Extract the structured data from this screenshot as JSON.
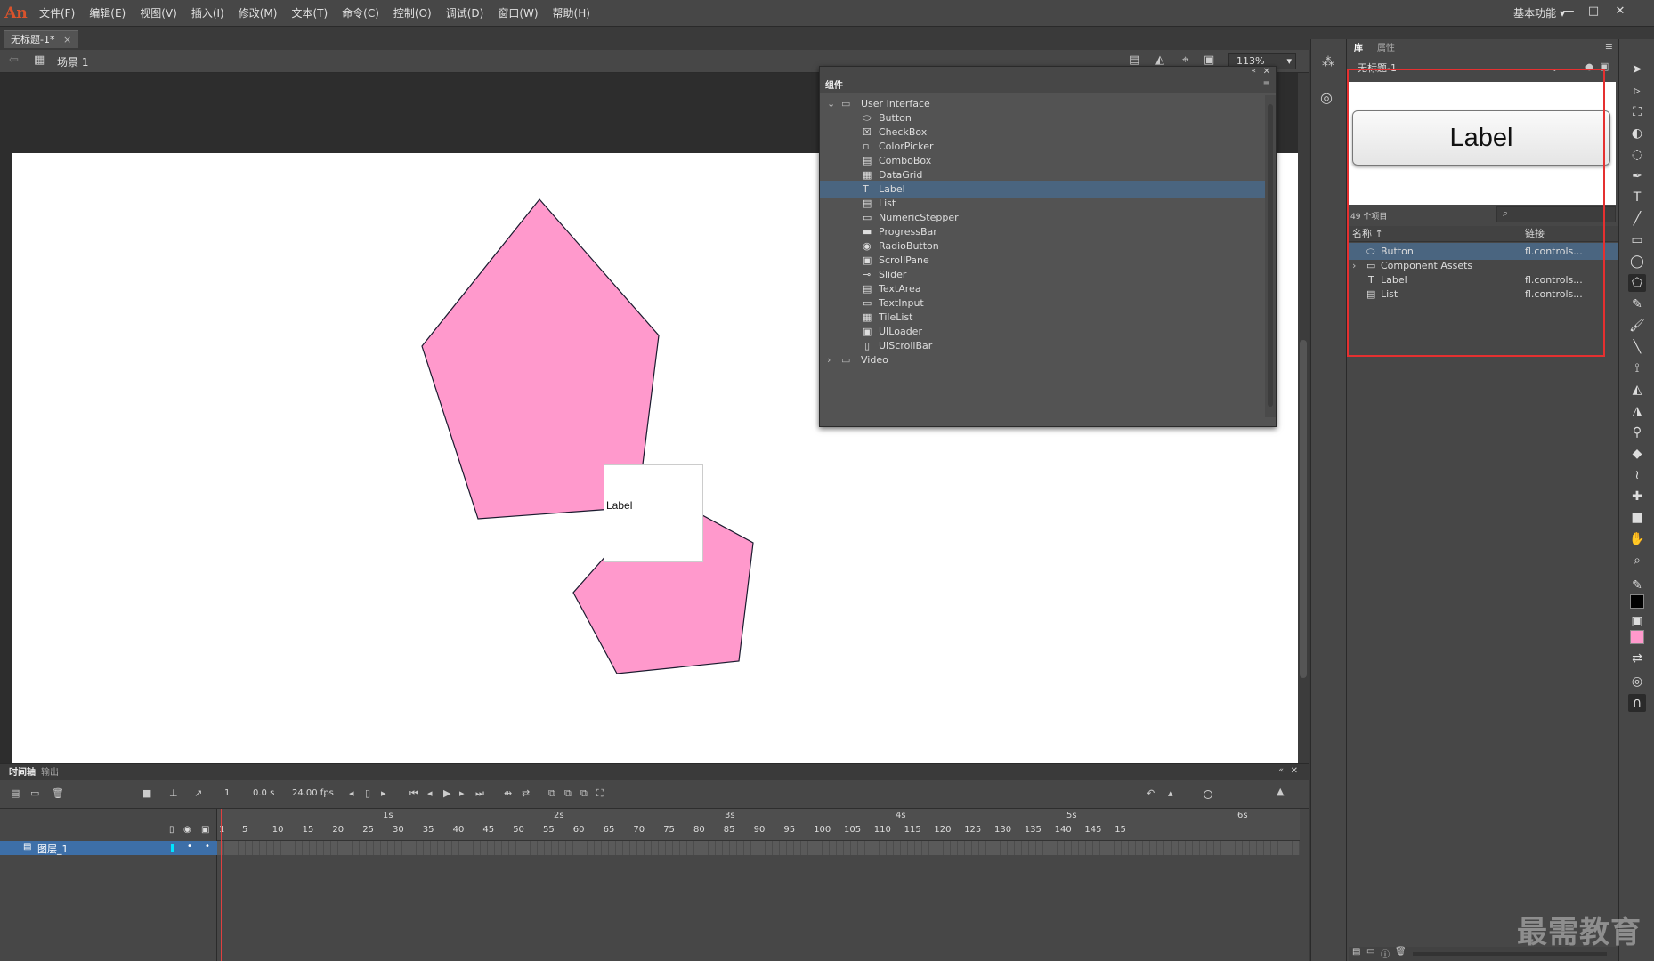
{
  "app": {
    "logo": "An"
  },
  "menu": [
    "文件(F)",
    "编辑(E)",
    "视图(V)",
    "插入(I)",
    "修改(M)",
    "文本(T)",
    "命令(C)",
    "控制(O)",
    "调试(D)",
    "窗口(W)",
    "帮助(H)"
  ],
  "workspace": "基本功能",
  "document": {
    "tab_title": "无标题-1*",
    "scene": "场景 1",
    "zoom": "113%"
  },
  "components_panel": {
    "tab": "组件",
    "folders": [
      {
        "name": "User Interface",
        "expanded": true,
        "items": [
          "Button",
          "CheckBox",
          "ColorPicker",
          "ComboBox",
          "DataGrid",
          "Label",
          "List",
          "NumericStepper",
          "ProgressBar",
          "RadioButton",
          "ScrollPane",
          "Slider",
          "TextArea",
          "TextInput",
          "TileList",
          "UILoader",
          "UIScrollBar"
        ]
      },
      {
        "name": "Video",
        "expanded": false,
        "items": []
      }
    ],
    "selected": "Label"
  },
  "stage": {
    "label_instance_text": "Label",
    "fill_color": "#ff99cc",
    "stroke_color": "#1a1a2e"
  },
  "timeline": {
    "tabs": [
      "时间轴",
      "输出"
    ],
    "current_frame": "1",
    "time": "0.0 s",
    "fps": "24.00 fps",
    "second_markers": [
      "1s",
      "2s",
      "3s",
      "4s",
      "5s",
      "6s"
    ],
    "frame_numbers": [
      "1",
      "5",
      "10",
      "15",
      "20",
      "25",
      "30",
      "35",
      "40",
      "45",
      "50",
      "55",
      "60",
      "65",
      "70",
      "75",
      "80",
      "85",
      "90",
      "95",
      "100",
      "105",
      "110",
      "115",
      "120",
      "125",
      "130",
      "135",
      "140",
      "145",
      "15"
    ],
    "layer_name": "图层_1"
  },
  "library": {
    "tabs": [
      "库",
      "属性"
    ],
    "document": "无标题-1",
    "preview_text": "Label",
    "item_count": "49 个项目",
    "columns": [
      "名称 ↑",
      "链接"
    ],
    "items": [
      {
        "name": "Button",
        "linkage": "fl.controls...",
        "icon": "button-icon"
      },
      {
        "name": "Component Assets",
        "linkage": "",
        "icon": "folder-icon"
      },
      {
        "name": "Label",
        "linkage": "fl.controls...",
        "icon": "text-icon"
      },
      {
        "name": "List",
        "linkage": "fl.controls...",
        "icon": "list-icon"
      }
    ]
  },
  "watermark": "最需教育"
}
